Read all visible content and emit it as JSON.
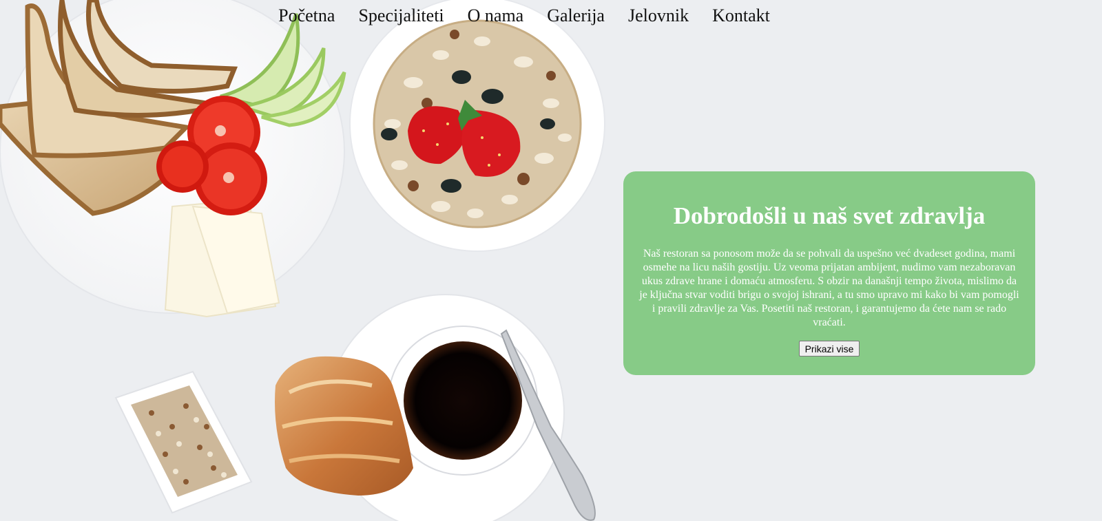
{
  "nav": {
    "items": [
      "Početna",
      "Specijaliteti",
      "O nama",
      "Galerija",
      "Jelovnik",
      "Kontakt"
    ]
  },
  "hero": {
    "title": "Dobrodošli u naš svet zdravlja",
    "text": "Naš restoran sa ponosom može da se pohvali da uspešno već dvadeset godina, mami osmehe na licu naših gostiju. Uz veoma prijatan ambijent, nudimo vam nezaboravan ukus zdrave hrane i domaću atmosferu. S obzir na današnji tempo života, mislimo da je ključna stvar voditi brigu o svojoj ishrani, a tu smo upravo mi kako bi vam pomogli i pravili zdravlje za Vas. Posetiti naš restoran, i garantujemo da ćete nam se rado vraćati.",
    "button_label": "Prikazi vise"
  },
  "colors": {
    "card_bg": "#87cb87",
    "page_bg": "#eceef1"
  }
}
